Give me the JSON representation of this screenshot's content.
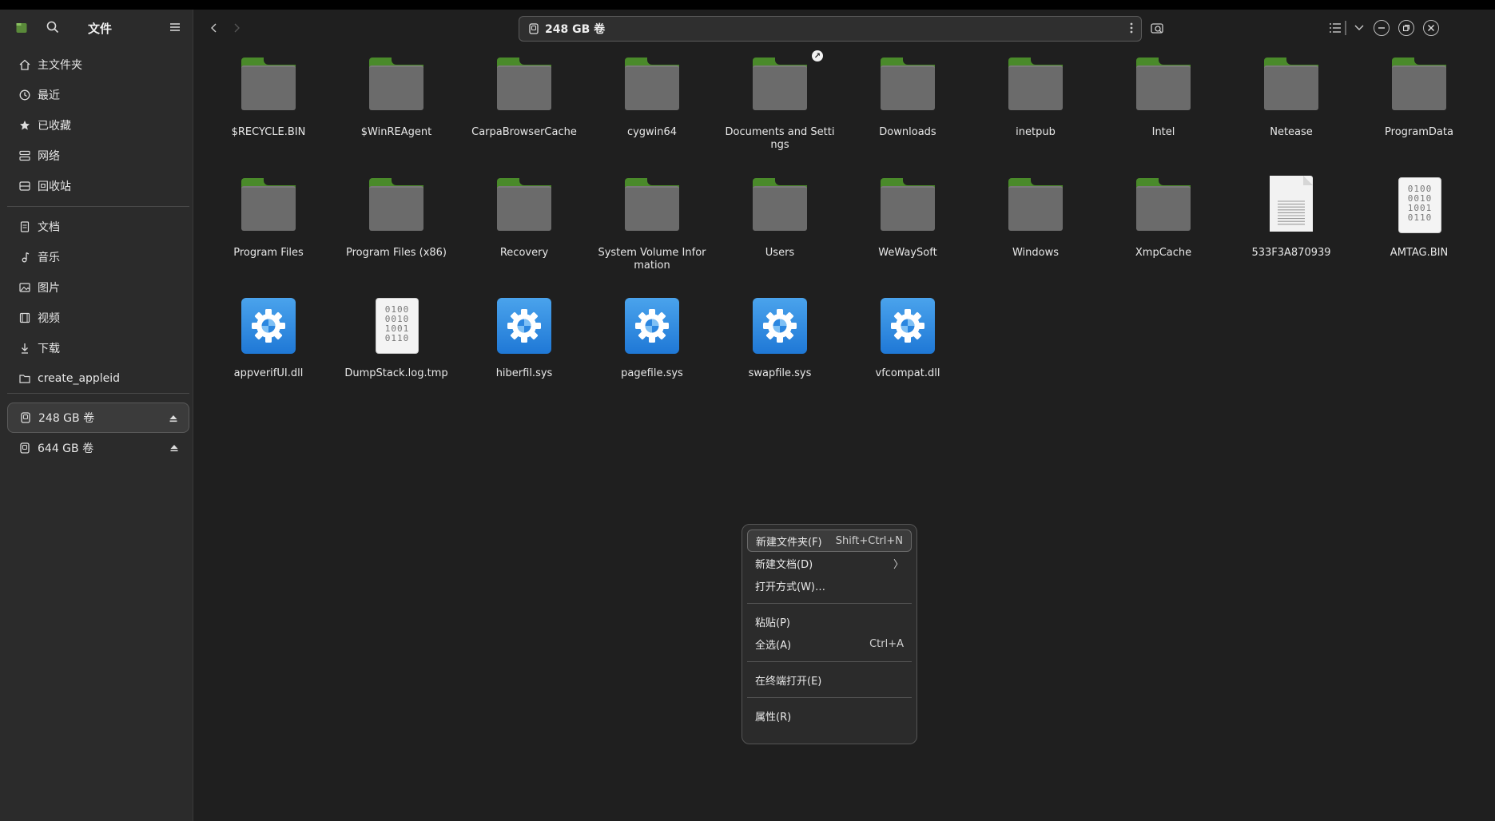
{
  "app": {
    "title": "文件"
  },
  "sidebar": {
    "places": [
      {
        "label": "主文件夹",
        "icon": "home-icon"
      },
      {
        "label": "最近",
        "icon": "clock-icon"
      },
      {
        "label": "已收藏",
        "icon": "star-icon"
      },
      {
        "label": "网络",
        "icon": "network-icon"
      },
      {
        "label": "回收站",
        "icon": "trash-icon"
      }
    ],
    "bookmarks": [
      {
        "label": "文档",
        "icon": "document-icon"
      },
      {
        "label": "音乐",
        "icon": "music-icon"
      },
      {
        "label": "图片",
        "icon": "picture-icon"
      },
      {
        "label": "视频",
        "icon": "video-icon"
      },
      {
        "label": "下载",
        "icon": "download-icon"
      },
      {
        "label": "create_appleid",
        "icon": "folder-icon"
      }
    ],
    "drives": [
      {
        "label": "248 GB 卷",
        "active": true
      },
      {
        "label": "644 GB 卷",
        "active": false
      }
    ]
  },
  "path": {
    "label": "248 GB 卷"
  },
  "files": [
    {
      "name": "$RECYCLE.BIN",
      "type": "folder"
    },
    {
      "name": "$WinREAgent",
      "type": "folder"
    },
    {
      "name": "CarpaBrowserCache",
      "type": "folder"
    },
    {
      "name": "cygwin64",
      "type": "folder"
    },
    {
      "name": "Documents and Settings",
      "type": "folder",
      "link": true
    },
    {
      "name": "Downloads",
      "type": "folder"
    },
    {
      "name": "inetpub",
      "type": "folder"
    },
    {
      "name": "Intel",
      "type": "folder"
    },
    {
      "name": "Netease",
      "type": "folder"
    },
    {
      "name": "ProgramData",
      "type": "folder"
    },
    {
      "name": "Program Files",
      "type": "folder"
    },
    {
      "name": "Program Files (x86)",
      "type": "folder"
    },
    {
      "name": "Recovery",
      "type": "folder"
    },
    {
      "name": "System Volume Information",
      "type": "folder"
    },
    {
      "name": "Users",
      "type": "folder"
    },
    {
      "name": "WeWaySoft",
      "type": "folder"
    },
    {
      "name": "Windows",
      "type": "folder"
    },
    {
      "name": "XmpCache",
      "type": "folder"
    },
    {
      "name": "533F3A870939",
      "type": "text"
    },
    {
      "name": "AMTAG.BIN",
      "type": "binary"
    },
    {
      "name": "appverifUI.dll",
      "type": "system"
    },
    {
      "name": "DumpStack.log.tmp",
      "type": "binary"
    },
    {
      "name": "hiberfil.sys",
      "type": "system"
    },
    {
      "name": "pagefile.sys",
      "type": "system"
    },
    {
      "name": "swapfile.sys",
      "type": "system"
    },
    {
      "name": "vfcompat.dll",
      "type": "system"
    }
  ],
  "binary_glyph": [
    "0100",
    "0010",
    "1001",
    "0110"
  ],
  "context_menu": [
    {
      "label": "新建文件夹(F)",
      "shortcut": "Shift+Ctrl+N",
      "highlight": true
    },
    {
      "label": "新建文档(D)",
      "shortcut": "〉"
    },
    {
      "label": "打开方式(W)…",
      "shortcut": ""
    },
    {
      "sep": true
    },
    {
      "label": "粘贴(P)",
      "shortcut": ""
    },
    {
      "label": "全选(A)",
      "shortcut": "Ctrl+A"
    },
    {
      "sep": true
    },
    {
      "label": "在终端打开(E)",
      "shortcut": ""
    },
    {
      "sep": true
    },
    {
      "label": "属性(R)",
      "shortcut": ""
    }
  ],
  "colors": {
    "accent_folder_tab": "#4a8a2a",
    "folder_body": "#6b6b6b",
    "gear_blue": "#2a86e0"
  }
}
